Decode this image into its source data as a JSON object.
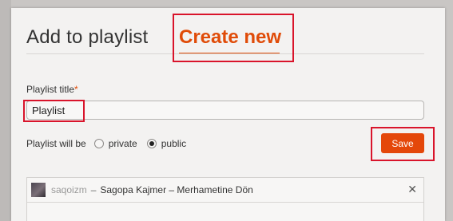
{
  "dialog": {
    "tabs": {
      "add_to_playlist": "Add to playlist",
      "create_new": "Create new"
    },
    "form": {
      "title_label": "Playlist title",
      "required_mark": "*",
      "title_value": "Playlist",
      "privacy_label": "Playlist will be",
      "privacy_options": [
        {
          "label": "private",
          "selected": false
        },
        {
          "label": "public",
          "selected": true
        }
      ],
      "save_label": "Save"
    },
    "tracks": [
      {
        "user": "saqoizm",
        "separator": "–",
        "title": "Sagopa Kajmer – Merhametine Dön",
        "remove_icon": "✕"
      }
    ]
  },
  "colors": {
    "accent": "#e04c09",
    "save_button": "#e4470a",
    "highlight_box": "#d9142b"
  },
  "icons": {
    "track_remove": "close-icon",
    "track_artwork": "track-thumbnail"
  }
}
